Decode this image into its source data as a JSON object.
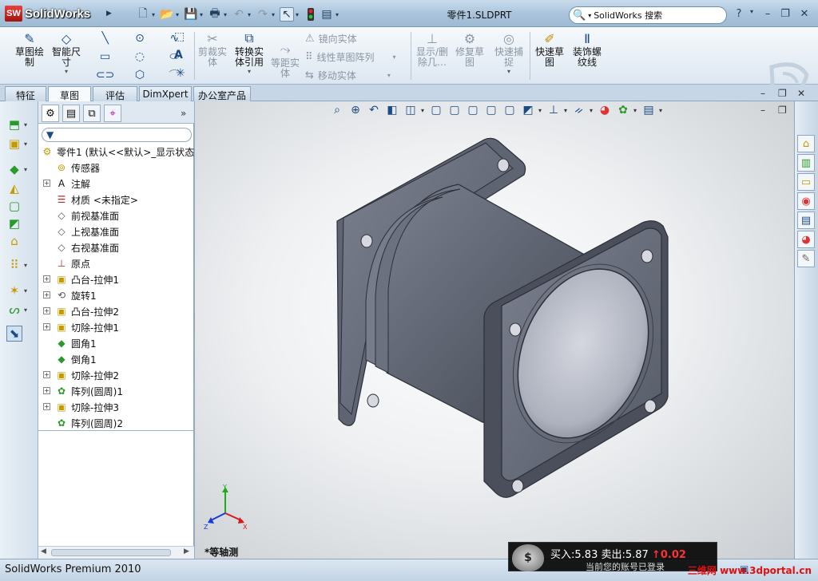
{
  "app": {
    "brand_badge": "SW",
    "name": "SolidWorks",
    "document_title": "零件1.SLDPRT"
  },
  "search": {
    "label": "SolidWorks 搜索"
  },
  "window_controls": {
    "help": "?",
    "minimize": "–",
    "restore": "❐",
    "close": "✕"
  },
  "ribbon": {
    "commands": [
      {
        "label": "草图绘\n制",
        "icon": "sketch-icon"
      },
      {
        "label": "智能尺\n寸",
        "icon": "smart-dimension-icon"
      },
      {
        "label": "剪裁实\n体",
        "icon": "trim-icon"
      },
      {
        "label": "转换实\n体引用",
        "icon": "convert-entities-icon"
      },
      {
        "label": "等距实\n体",
        "icon": "offset-entities-icon"
      },
      {
        "label": "显示/删\n除几…",
        "icon": "display-relations-icon"
      },
      {
        "label": "修复草\n图",
        "icon": "repair-sketch-icon"
      },
      {
        "label": "快速捕\n捉",
        "icon": "quick-snaps-icon"
      },
      {
        "label": "快速草\n图",
        "icon": "rapid-sketch-icon"
      },
      {
        "label": "装饰螺\n纹线",
        "icon": "cosmetic-thread-icon"
      }
    ],
    "row_commands": [
      {
        "label": "镜向实体",
        "icon": "mirror-icon"
      },
      {
        "label": "线性草图阵列",
        "icon": "linear-pattern-icon"
      },
      {
        "label": "移动实体",
        "icon": "move-entities-icon"
      }
    ]
  },
  "tabs": [
    "特征",
    "草图",
    "评估",
    "DimXpert",
    "办公室产品"
  ],
  "active_tab": "草图",
  "feature_tree": {
    "root": "零件1 (默认<<默认>_显示状态",
    "items": [
      {
        "label": "传感器",
        "icon": "sensor-icon",
        "expandable": false
      },
      {
        "label": "注解",
        "icon": "annotations-icon",
        "expandable": true
      },
      {
        "label": "材质 <未指定>",
        "icon": "material-icon",
        "expandable": false
      },
      {
        "label": "前视基准面",
        "icon": "plane-icon",
        "expandable": false
      },
      {
        "label": "上视基准面",
        "icon": "plane-icon",
        "expandable": false
      },
      {
        "label": "右视基准面",
        "icon": "plane-icon",
        "expandable": false
      },
      {
        "label": "原点",
        "icon": "origin-icon",
        "expandable": false
      },
      {
        "label": "凸台-拉伸1",
        "icon": "boss-extrude-icon",
        "expandable": true
      },
      {
        "label": "旋转1",
        "icon": "revolve-icon",
        "expandable": true
      },
      {
        "label": "凸台-拉伸2",
        "icon": "boss-extrude-icon",
        "expandable": true
      },
      {
        "label": "切除-拉伸1",
        "icon": "cut-extrude-icon",
        "expandable": true
      },
      {
        "label": "圆角1",
        "icon": "fillet-icon",
        "expandable": false
      },
      {
        "label": "倒角1",
        "icon": "chamfer-icon",
        "expandable": false
      },
      {
        "label": "切除-拉伸2",
        "icon": "cut-extrude-icon",
        "expandable": true
      },
      {
        "label": "阵列(圆周)1",
        "icon": "circular-pattern-icon",
        "expandable": true
      },
      {
        "label": "切除-拉伸3",
        "icon": "cut-extrude-icon",
        "expandable": true
      },
      {
        "label": "阵列(圆周)2",
        "icon": "circular-pattern-icon",
        "expandable": false
      }
    ]
  },
  "viewport": {
    "view_label": "*等轴测",
    "triad": {
      "x": "X",
      "y": "Y",
      "z": "Z"
    }
  },
  "statusbar": {
    "text": "SolidWorks Premium 2010"
  },
  "overlay": {
    "quote": {
      "buy_label": "买入:",
      "buy": "5.83",
      "sell_label": "卖出:",
      "sell": "5.87",
      "change": "0.02"
    },
    "account_text": "当前您的账号已登录",
    "brand": "三维网 www.3dportal.cn"
  },
  "colors": {
    "title_bar": "#a9c3db",
    "part_body": "#6d7280",
    "up_arrow": "#ff3030"
  }
}
